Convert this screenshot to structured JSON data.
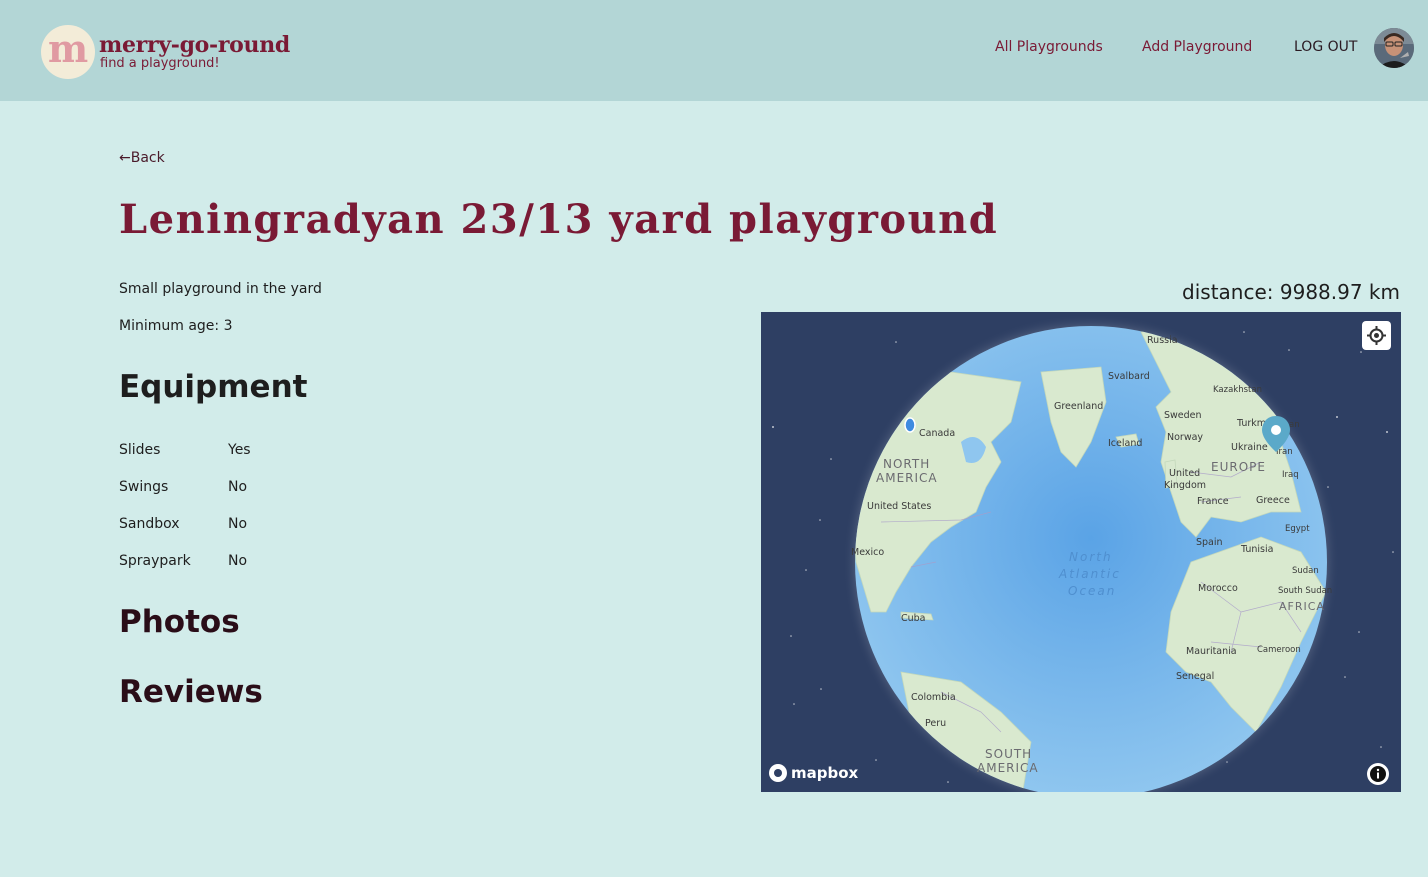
{
  "header": {
    "logo_letter": "m",
    "brand_name": "merry-go-round",
    "tagline": "find a playground!",
    "nav": {
      "all_playgrounds": "All Playgrounds",
      "add_playground": "Add Playground",
      "log_out": "LOG OUT"
    }
  },
  "page": {
    "back_label": "←Back",
    "title": "Leningradyan 23/13 yard playground",
    "description": "Small playground in the yard",
    "minimum_age": "Minimum age: 3",
    "distance": "distance: 9988.97 km"
  },
  "equipment": {
    "heading": "Equipment",
    "items": [
      {
        "name": "Slides",
        "value": "Yes"
      },
      {
        "name": "Swings",
        "value": "No"
      },
      {
        "name": "Sandbox",
        "value": "No"
      },
      {
        "name": "Spraypark",
        "value": "No"
      }
    ]
  },
  "photos": {
    "heading": "Photos"
  },
  "reviews": {
    "heading": "Reviews"
  },
  "map": {
    "attribution": "mapbox",
    "labels": {
      "russia": "Russia",
      "svalbard": "Svalbard",
      "kazakhstan": "Kazakhstan",
      "greenland": "Greenland",
      "sweden": "Sweden",
      "turkmenistan": "Turkm",
      "turkmenistan_end": "an",
      "canada": "Canada",
      "iceland": "Iceland",
      "norway": "Norway",
      "ukraine": "Ukraine",
      "iran": "Iran",
      "north_america_1": "NORTH",
      "north_america_2": "AMERICA",
      "united_kingdom_1": "United",
      "united_kingdom_2": "Kingdom",
      "europe": "EUROPE",
      "iraq": "Iraq",
      "united_states": "United States",
      "france": "France",
      "greece": "Greece",
      "egypt": "Egypt",
      "mexico": "Mexico",
      "spain": "Spain",
      "tunisia": "Tunisia",
      "atlantic_1": "North",
      "atlantic_2": "Atlantic",
      "atlantic_3": "Ocean",
      "sudan": "Sudan",
      "morocco": "Morocco",
      "south_sudan": "South Sudan",
      "africa": "AFRICA",
      "cuba": "Cuba",
      "mauritania": "Mauritania",
      "cameroon": "Cameroon",
      "senegal": "Senegal",
      "colombia": "Colombia",
      "peru": "Peru",
      "south_america_1": "SOUTH",
      "south_america_2": "AMERICA"
    }
  },
  "colors": {
    "header_bg": "#b3d6d6",
    "page_bg": "#d2ecea",
    "brand": "#7a1a35",
    "map_space": "#2e3f63",
    "ocean": "#6fb2ea",
    "land": "#d9e9cf",
    "marker": "#5ba9c9"
  }
}
